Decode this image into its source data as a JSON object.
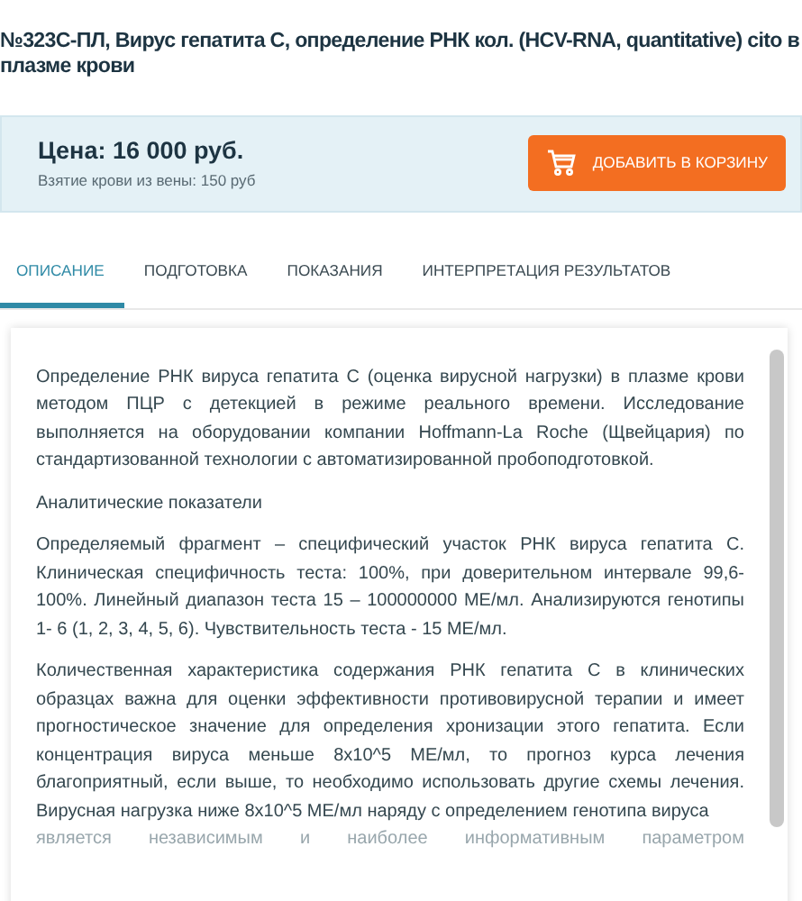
{
  "title": "№323С-ПЛ, Вирус гепатита С, определение РНК кол. (HCV-RNA, quantitative) cito в плазме крови",
  "price": {
    "label": "Цена: 16 000 руб.",
    "note": "Взятие крови из вены:  150 руб",
    "button": "ДОБАВИТЬ В КОРЗИНУ"
  },
  "tabs": [
    {
      "label": "ОПИСАНИЕ",
      "selected": true
    },
    {
      "label": "ПОДГОТОВКА",
      "selected": false
    },
    {
      "label": "ПОКАЗАНИЯ",
      "selected": false
    },
    {
      "label": "ИНТЕРПРЕТАЦИЯ РЕЗУЛЬТАТОВ",
      "selected": false
    }
  ],
  "description": [
    {
      "text": "Определение РНК вируса гепатита С (оценка вирусной нагрузки) в плазме крови методом ПЦР с детекцией в режиме реального времени. Исследование выполняется на оборудовании компании Hoffmann-La Roche (Щвейцария) по стандартизованной технологии с автоматизированной пробоподготовкой."
    },
    {
      "text": "Аналитические показатели"
    },
    {
      "text": "Определяемый фрагмент – специфический участок РНК вируса гепатита С. Клиническая специфичность теста: 100%, при доверительном интервале 99,6-100%. Линейный диапазон теста 15 – 100000000 МЕ/мл. Анализируются генотипы 1- 6 (1, 2, 3, 4, 5, 6). Чувствительность теста - 15 МЕ/мл."
    },
    {
      "text": "Количественная характеристика содержания РНК гепатита С в клинических образцах важна для оценки эффективности противовирусной терапии и имеет прогностическое значение для определения хронизации этого гепатита. Если концентрация вируса меньше 8x10^5 МЕ/мл, то прогноз курса лечения благоприятный, если выше, то необходимо использовать другие схемы лечения. Вирусная нагрузка ниже 8x10^5 МЕ/мл наряду с определением генотипа вируса",
      "faded": "является независимым и наиболее информативным параметром"
    }
  ]
}
